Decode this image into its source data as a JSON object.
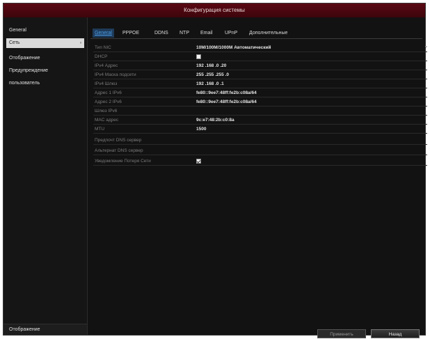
{
  "window": {
    "title": "Конфигурация системы"
  },
  "sidebar": {
    "items": [
      {
        "label": "General"
      },
      {
        "label": "Сеть",
        "arrow": "›"
      },
      {
        "label": "Отображение"
      },
      {
        "label": "Предупреждение"
      },
      {
        "label": "пользователь"
      }
    ],
    "bottom_label": "Отображение"
  },
  "tabs": [
    "General",
    "PPPOE",
    "DDNS",
    "NTP",
    "Email",
    "UPnP",
    "Дополнительные"
  ],
  "form": {
    "nic_type": {
      "label": "Тип NIC",
      "value": "10M/100M/1000M Автоматический"
    },
    "dhcp": {
      "label": "DHCP",
      "checked": false
    },
    "ipv4_addr": {
      "label": "IPv4 Адрес",
      "value": "192 .168 .0 .20"
    },
    "ipv4_mask": {
      "label": "IPv4 Маска подсети",
      "value": "255 .255 .255 .0"
    },
    "ipv4_gateway": {
      "label": "IPv4 Шлюз",
      "value": "192 .168 .0 .1"
    },
    "ipv6_addr1": {
      "label": "Адрес 1 IPv6",
      "value": "fe80::9ee7:48ff:fe2b:c08a/64"
    },
    "ipv6_addr2": {
      "label": "Адрес 2 IPv6",
      "value": "fe80::9ee7:48ff:fe2b:c08a/64"
    },
    "ipv6_gateway": {
      "label": "Шлюз IPv6",
      "value": ""
    },
    "mac": {
      "label": "MAC адрес",
      "value": "9c:e7:48:2b:c0:8a"
    },
    "mtu": {
      "label": "MTU",
      "value": "1500"
    },
    "dns_pref": {
      "label": "Предпочт DNS сервер",
      "value": ""
    },
    "dns_alt": {
      "label": "Альтернат DNS сервер",
      "value": ""
    },
    "net_alarm": {
      "label": "Уведомление Потеря Сети",
      "checked": true
    }
  },
  "buttons": {
    "apply": "Применить",
    "back": "Назад"
  },
  "colors": {
    "titlebar": "#4a0610",
    "tab_active": "#4a9ee8"
  }
}
